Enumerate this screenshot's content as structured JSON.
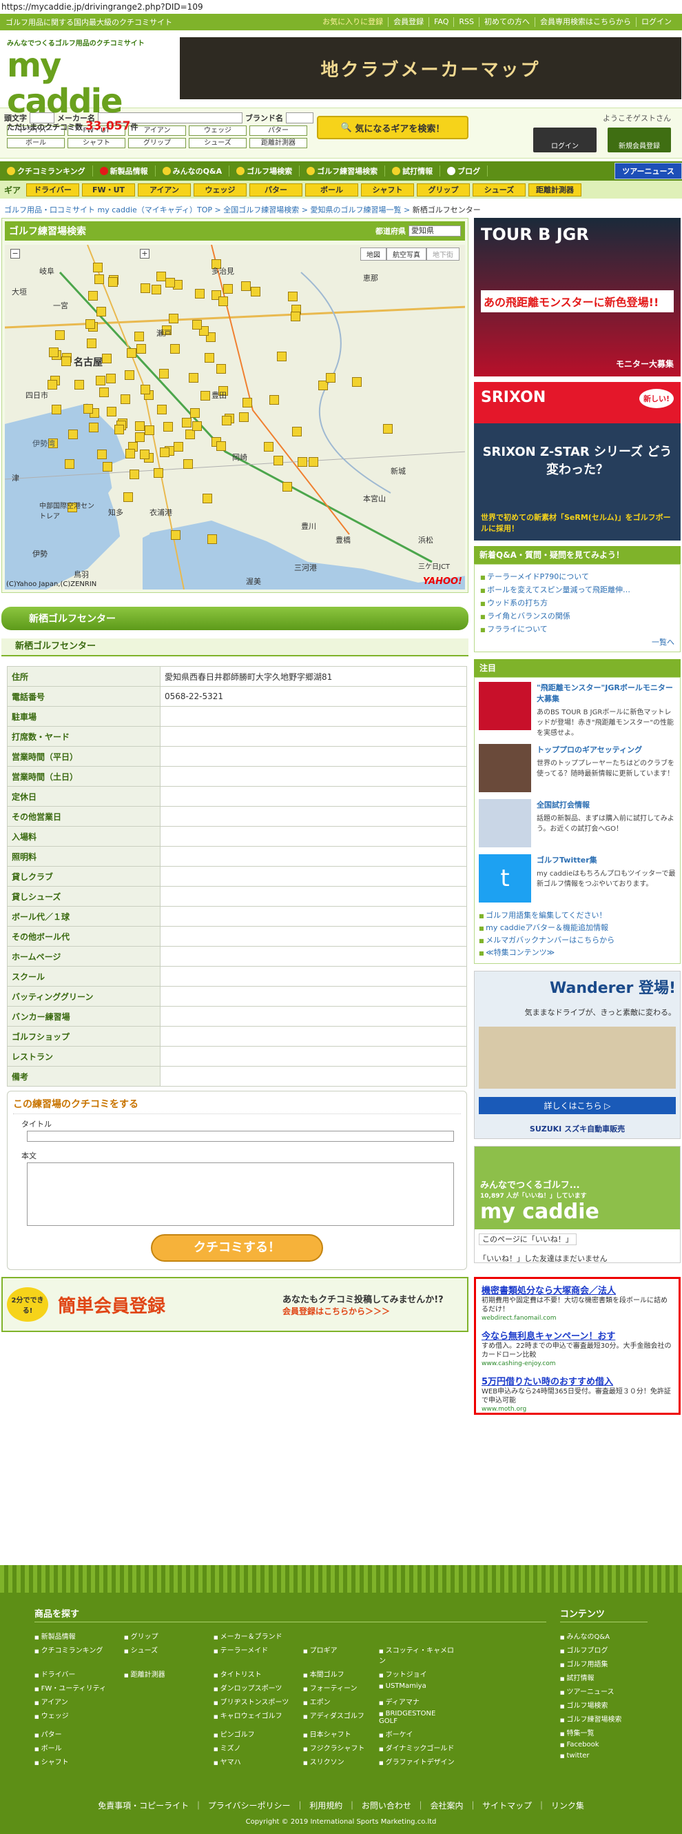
{
  "url": "https://mycaddie.jp/drivingrange2.php?DID=109",
  "topbar": {
    "tagline": "ゴルフ用品に関する国内最大級のクチコミサイト",
    "nav": [
      "お気に入りに登録",
      "会員登録",
      "FAQ",
      "RSS",
      "初めての方へ",
      "会員専用検索はこちらから",
      "ログイン"
    ]
  },
  "logo": {
    "tagline": "みんなでつくるゴルフ用品のクチコミサイト",
    "brand": "my caddie",
    "count_prefix": "ただいまのクチコミ数",
    "count": "33,057",
    "count_suffix": "件"
  },
  "banner_top": "地クラブメーカーマップ",
  "search": {
    "initial_label": "頭文字",
    "maker_label": "メーカー名",
    "brand_label": "ブランド名",
    "chips": [
      "ドライバー",
      "FW・UT",
      "アイアン",
      "ウェッジ",
      "パター",
      "ボール",
      "シャフト",
      "グリップ",
      "シューズ",
      "距離計測器"
    ],
    "button": "気になるギアを検索！"
  },
  "login": {
    "welcome": "ようこそゲストさん",
    "login_btn": "ログイン",
    "register_btn": "新規会員登録"
  },
  "mainnav": [
    "クチコミランキング",
    "新製品情報",
    "みんなのQ&A",
    "ゴルフ場検索",
    "ゴルフ練習場検索",
    "試打情報",
    "ブログ",
    "ツアーニュース"
  ],
  "gearnav": {
    "label": "ギア",
    "items": [
      "ドライバー",
      "FW・UT",
      "アイアン",
      "ウェッジ",
      "パター",
      "ボール",
      "シャフト",
      "グリップ",
      "シューズ",
      "距離計測器"
    ]
  },
  "breadcrumb": [
    "ゴルフ用品・口コミサイト my caddie（マイキャディ）TOP",
    "全国ゴルフ練習場検索",
    "愛知県のゴルフ練習場一覧",
    "新栖ゴルフセンター"
  ],
  "map": {
    "title": "ゴルフ練習場検索",
    "pref_label": "都道府県",
    "pref_value": "愛知県",
    "tabs": [
      "地図",
      "航空写真",
      "地下街"
    ],
    "copyright": "(C)Yahoo Japan,(C)ZENRIN",
    "places": [
      "名古屋",
      "伊勢湾",
      "中部国際空港セントレア",
      "知多",
      "衣浦港",
      "豊田",
      "岡崎",
      "豊川",
      "豊橋",
      "三河港",
      "渥美",
      "鳥羽",
      "伊勢",
      "津",
      "四日市",
      "瀬戸",
      "一宮",
      "岐阜",
      "大垣",
      "浜松",
      "新城",
      "恵那",
      "多治見",
      "本宮山",
      "三ケ日JCT"
    ]
  },
  "facility": {
    "header": "新栖ゴルフセンター",
    "subheader": "新栖ゴルフセンター",
    "rows": [
      {
        "k": "住所",
        "v": "愛知県西春日井郡師勝町大字久地野字郷湖81"
      },
      {
        "k": "電話番号",
        "v": "0568-22-5321"
      },
      {
        "k": "駐車場",
        "v": ""
      },
      {
        "k": "打席数・ヤード",
        "v": ""
      },
      {
        "k": "営業時間（平日）",
        "v": ""
      },
      {
        "k": "営業時間（土日）",
        "v": ""
      },
      {
        "k": "定休日",
        "v": ""
      },
      {
        "k": "その他営業日",
        "v": ""
      },
      {
        "k": "入場料",
        "v": ""
      },
      {
        "k": "照明料",
        "v": ""
      },
      {
        "k": "貸しクラブ",
        "v": ""
      },
      {
        "k": "貸しシューズ",
        "v": ""
      },
      {
        "k": "ボール代／１球",
        "v": ""
      },
      {
        "k": "その他ボール代",
        "v": ""
      },
      {
        "k": "ホームページ",
        "v": ""
      },
      {
        "k": "スクール",
        "v": ""
      },
      {
        "k": "バッティンググリーン",
        "v": ""
      },
      {
        "k": "バンカー練習場",
        "v": ""
      },
      {
        "k": "ゴルフショップ",
        "v": ""
      },
      {
        "k": "レストラン",
        "v": ""
      },
      {
        "k": "備考",
        "v": ""
      }
    ]
  },
  "review": {
    "title": "この練習場のクチコミをする",
    "title_label": "タイトル",
    "body_label": "本文",
    "submit": "クチコミする！"
  },
  "signup": {
    "badge": "2分でできる!",
    "big": "簡単会員登録",
    "line1": "あなたもクチコミ投稿してみませんか!?",
    "line2": "会員登録はこちらから＞＞＞"
  },
  "ads": {
    "ad1_top": "TOUR B JGR",
    "ad1_mid": "あの飛距離モンスターに新色登場!!",
    "ad1_btn": "モニター大募集",
    "ad2_brand": "SRIXON",
    "ad2_tag": "新しい!",
    "ad2_head": "SRIXON Z-STAR シリーズ どう変わった？",
    "ad2_sub": "世界で初めての新素材「SeRM(セルム)」をゴルフボールに採用！"
  },
  "qa": {
    "title": "新着Q&A・質問・疑問を見てみよう！",
    "items": [
      "テーラーメイドP790について",
      "ボールを変えてスピン量減って飛距離伸…",
      "ウッド系の打ち方",
      "ライ角とバランスの関係",
      "フラライについて"
    ],
    "more": "一覧へ"
  },
  "featured": {
    "title": "注目",
    "items": [
      {
        "t": "\"飛距離モンスター\"JGRボールモニター大募集",
        "d": "あのBS TOUR B JGRボールに新色マットレッドが登場！赤き\"飛距離モンスター\"の性能を実感せよ。"
      },
      {
        "t": "トッププロのギアセッティング",
        "d": "世界のトッププレーヤーたちはどのクラブを使ってる？随時最新情報に更新しています！"
      },
      {
        "t": "全国試打会情報",
        "d": "話題の新製品、まずは購入前に試打してみよう。お近くの試打会へGO！"
      },
      {
        "t": "ゴルフTwitter集",
        "d": "my caddieはもちろんプロもツイッターで最新ゴルフ情報をつぶやいております。"
      }
    ],
    "links": [
      "ゴルフ用語集を編集してください！",
      "my caddieアバター＆機能追加情報",
      "メルマガバックナンバーはこちらから",
      "≪特集コンテンツ≫"
    ]
  },
  "car_ad": {
    "title": "Wanderer 登場!",
    "sub": "気ままなドライブが、きっと素敵に変わる。",
    "btn": "詳しくはこちら ▷",
    "brand": "SUZUKI スズキ自動車販売"
  },
  "fb": {
    "header": "みんなでつくるゴルフ...",
    "likes": "10,897 人が「いいね！」しています",
    "brand": "my caddie",
    "like_btn": "このページに「いいね！」",
    "friends": "「いいね！」した友達はまだいません"
  },
  "google_ads": [
    {
      "t": "機密書類処分なら大塚商会／法人",
      "d": "初期費用や固定費は不要！大切な機密書類を段ボールに詰めるだけ！",
      "u": "webdirect.fanomail.com"
    },
    {
      "t": "今なら無利息キャンペーン！おす",
      "d": "すめ借入。22時までの申込で審査最短30分。大手金融会社のカードローン比較",
      "u": "www.cashing-enjoy.com"
    },
    {
      "t": "5万円借りたい時のおすすめ借入",
      "d": "WEB申込みなら24時間365日受付。審査最短３０分！免許証で申込可能",
      "u": "www.moth.org"
    }
  ],
  "footer": {
    "products_title": "商品を探す",
    "products": [
      "新製品情報",
      "グリップ",
      "メーカー＆ブランド",
      "",
      "",
      "クチコミランキング",
      "シューズ",
      "テーラーメイド",
      "プロギア",
      "スコッティ・キャメロン",
      "ドライバー",
      "距離計測器",
      "タイトリスト",
      "本間ゴルフ",
      "フットジョイ",
      "FW・ユーティリティ",
      "",
      "ダンロップスポーツ",
      "フォーティーン",
      "USTMamiya",
      "アイアン",
      "",
      "ブリヂストンスポーツ",
      "エポン",
      "ディアマナ",
      "ウェッジ",
      "",
      "キャロウェイゴルフ",
      "アディダスゴルフ",
      "BRIDGESTONE GOLF",
      "パター",
      "",
      "ピンゴルフ",
      "日本シャフト",
      "ボーケイ",
      "ボール",
      "",
      "ミズノ",
      "フジクラシャフト",
      "ダイナミックゴールド",
      "シャフト",
      "",
      "ヤマハ",
      "スリクソン",
      "グラファイトデザイン"
    ],
    "contents_title": "コンテンツ",
    "contents": [
      "みんなのQ&A",
      "ゴルフブログ",
      "ゴルフ用語集",
      "試打情報",
      "ツアーニュース",
      "ゴルフ場検索",
      "ゴルフ練習場検索",
      "特集一覧",
      "Facebook",
      "twitter"
    ],
    "links": [
      "免責事項・コピーライト",
      "プライバシーポリシー",
      "利用規約",
      "お問い合わせ",
      "会社案内",
      "サイトマップ",
      "リンク集"
    ],
    "copyright": "Copyright © 2019 International Sports Marketing.co.ltd"
  },
  "colors": {
    "green": "#7fb32a",
    "dark_green": "#5d8f16",
    "yellow": "#f6d31a",
    "link": "#2d6fb3",
    "accent": "#e04616"
  }
}
